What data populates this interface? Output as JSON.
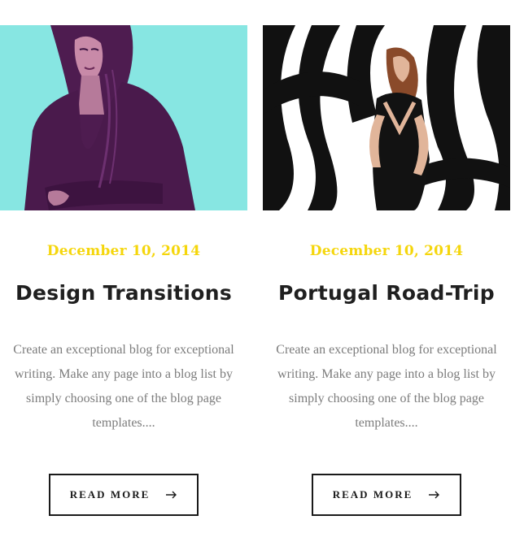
{
  "posts": [
    {
      "image": "woman-portrait-photo",
      "date": "December 10, 2014",
      "title": "Design Transitions",
      "excerpt": "Create an exceptional blog for exceptional writing. Make any page into a blog list by simply choosing one of the blog page templates....",
      "button_label": "READ MORE",
      "button_icon": "arrow-right-icon"
    },
    {
      "image": "woman-striped-wall-photo",
      "date": "December 10, 2014",
      "title": "Portugal Road-Trip",
      "excerpt": "Create an exceptional blog for exceptional writing. Make any page into a blog list by simply choosing one of the blog page templates....",
      "button_label": "READ MORE",
      "button_icon": "arrow-right-icon"
    }
  ],
  "colors": {
    "date": "#f5d60c",
    "title": "#1f1f1f",
    "excerpt": "#7c7c7c",
    "button_border": "#1a1a1a",
    "image1_bg": "#8be8e4",
    "image1_figure": "#5a1f5a"
  }
}
